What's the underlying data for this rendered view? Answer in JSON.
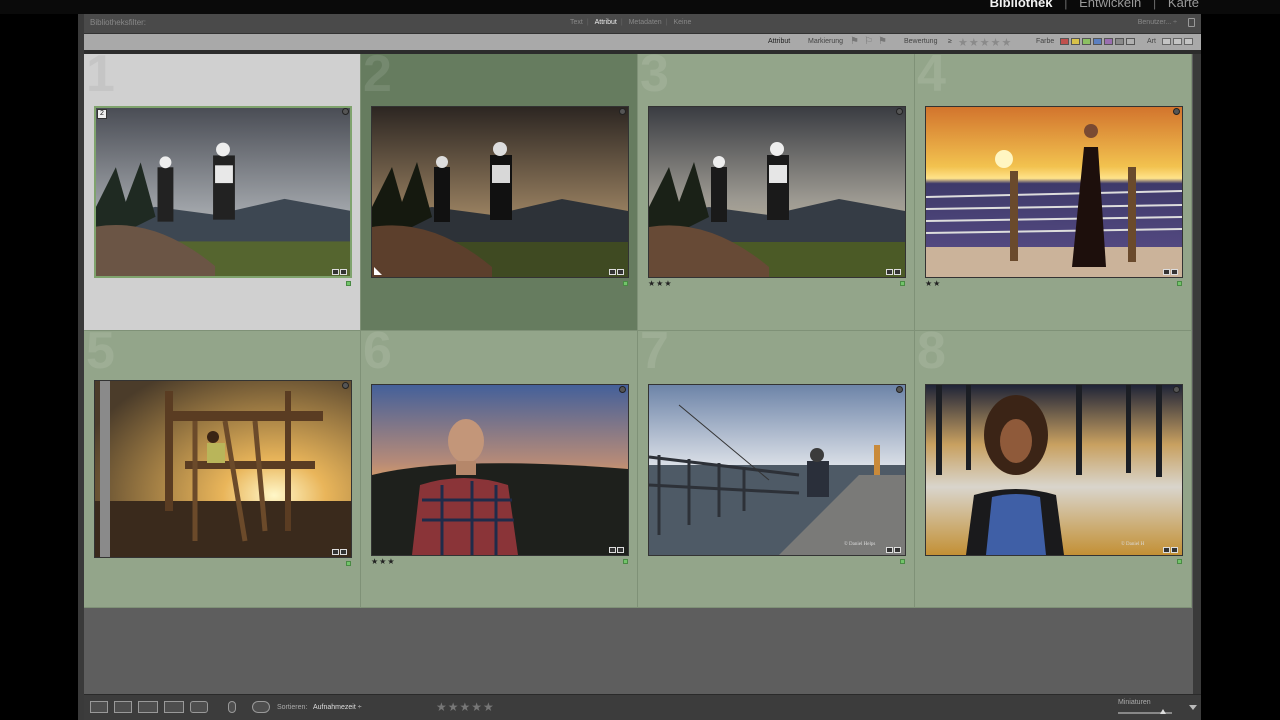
{
  "modules": {
    "library": "Bibliothek",
    "develop": "Entwickeln",
    "map": "Karte",
    "sep": "|"
  },
  "filter_bar": {
    "label": "Bibliotheksfilter:",
    "tabs": [
      "Text",
      "Attribut",
      "Metadaten",
      "Keine"
    ],
    "active_tab": "Attribut",
    "preset": "Benutzer... ÷"
  },
  "attribute_bar": {
    "attribute": "Attribut",
    "flag_label": "Markierung",
    "rating_label": "Bewertung",
    "rating_op": "≥",
    "rating_stars": "★★★★★",
    "color_label": "Farbe",
    "kind_label": "Art",
    "color_swatches": [
      "#c0504d",
      "#d8c24a",
      "#8cc063",
      "#5b7fc0",
      "#9a6fb0",
      "#8a8a8a",
      "#b0b0b0"
    ]
  },
  "cells": [
    {
      "index": "1",
      "badge": "2",
      "stars": "",
      "selected": true,
      "dark": false,
      "pick": false,
      "watermark": ""
    },
    {
      "index": "2",
      "badge": "",
      "stars": "",
      "selected": false,
      "dark": true,
      "pick": true,
      "watermark": ""
    },
    {
      "index": "3",
      "badge": "",
      "stars": "★★★",
      "selected": false,
      "dark": false,
      "pick": false,
      "watermark": ""
    },
    {
      "index": "4",
      "badge": "",
      "stars": "★★",
      "selected": false,
      "dark": false,
      "pick": false,
      "watermark": ""
    },
    {
      "index": "5",
      "badge": "",
      "stars": "",
      "selected": false,
      "dark": false,
      "pick": false,
      "watermark": ""
    },
    {
      "index": "6",
      "badge": "",
      "stars": "★★★",
      "selected": false,
      "dark": false,
      "pick": false,
      "watermark": ""
    },
    {
      "index": "7",
      "badge": "",
      "stars": "",
      "selected": false,
      "dark": false,
      "pick": false,
      "watermark": "© Daniel Helps"
    },
    {
      "index": "8",
      "badge": "",
      "stars": "",
      "selected": false,
      "dark": false,
      "pick": false,
      "watermark": "© Daniel H"
    }
  ],
  "toolbar": {
    "sort_label": "Sortieren:",
    "sort_value": "Aufnahmezeit ÷",
    "rating_stars": "★★★★★",
    "thumbs_label": "Miniaturen",
    "sort_icon": "A-Z sort icon"
  }
}
